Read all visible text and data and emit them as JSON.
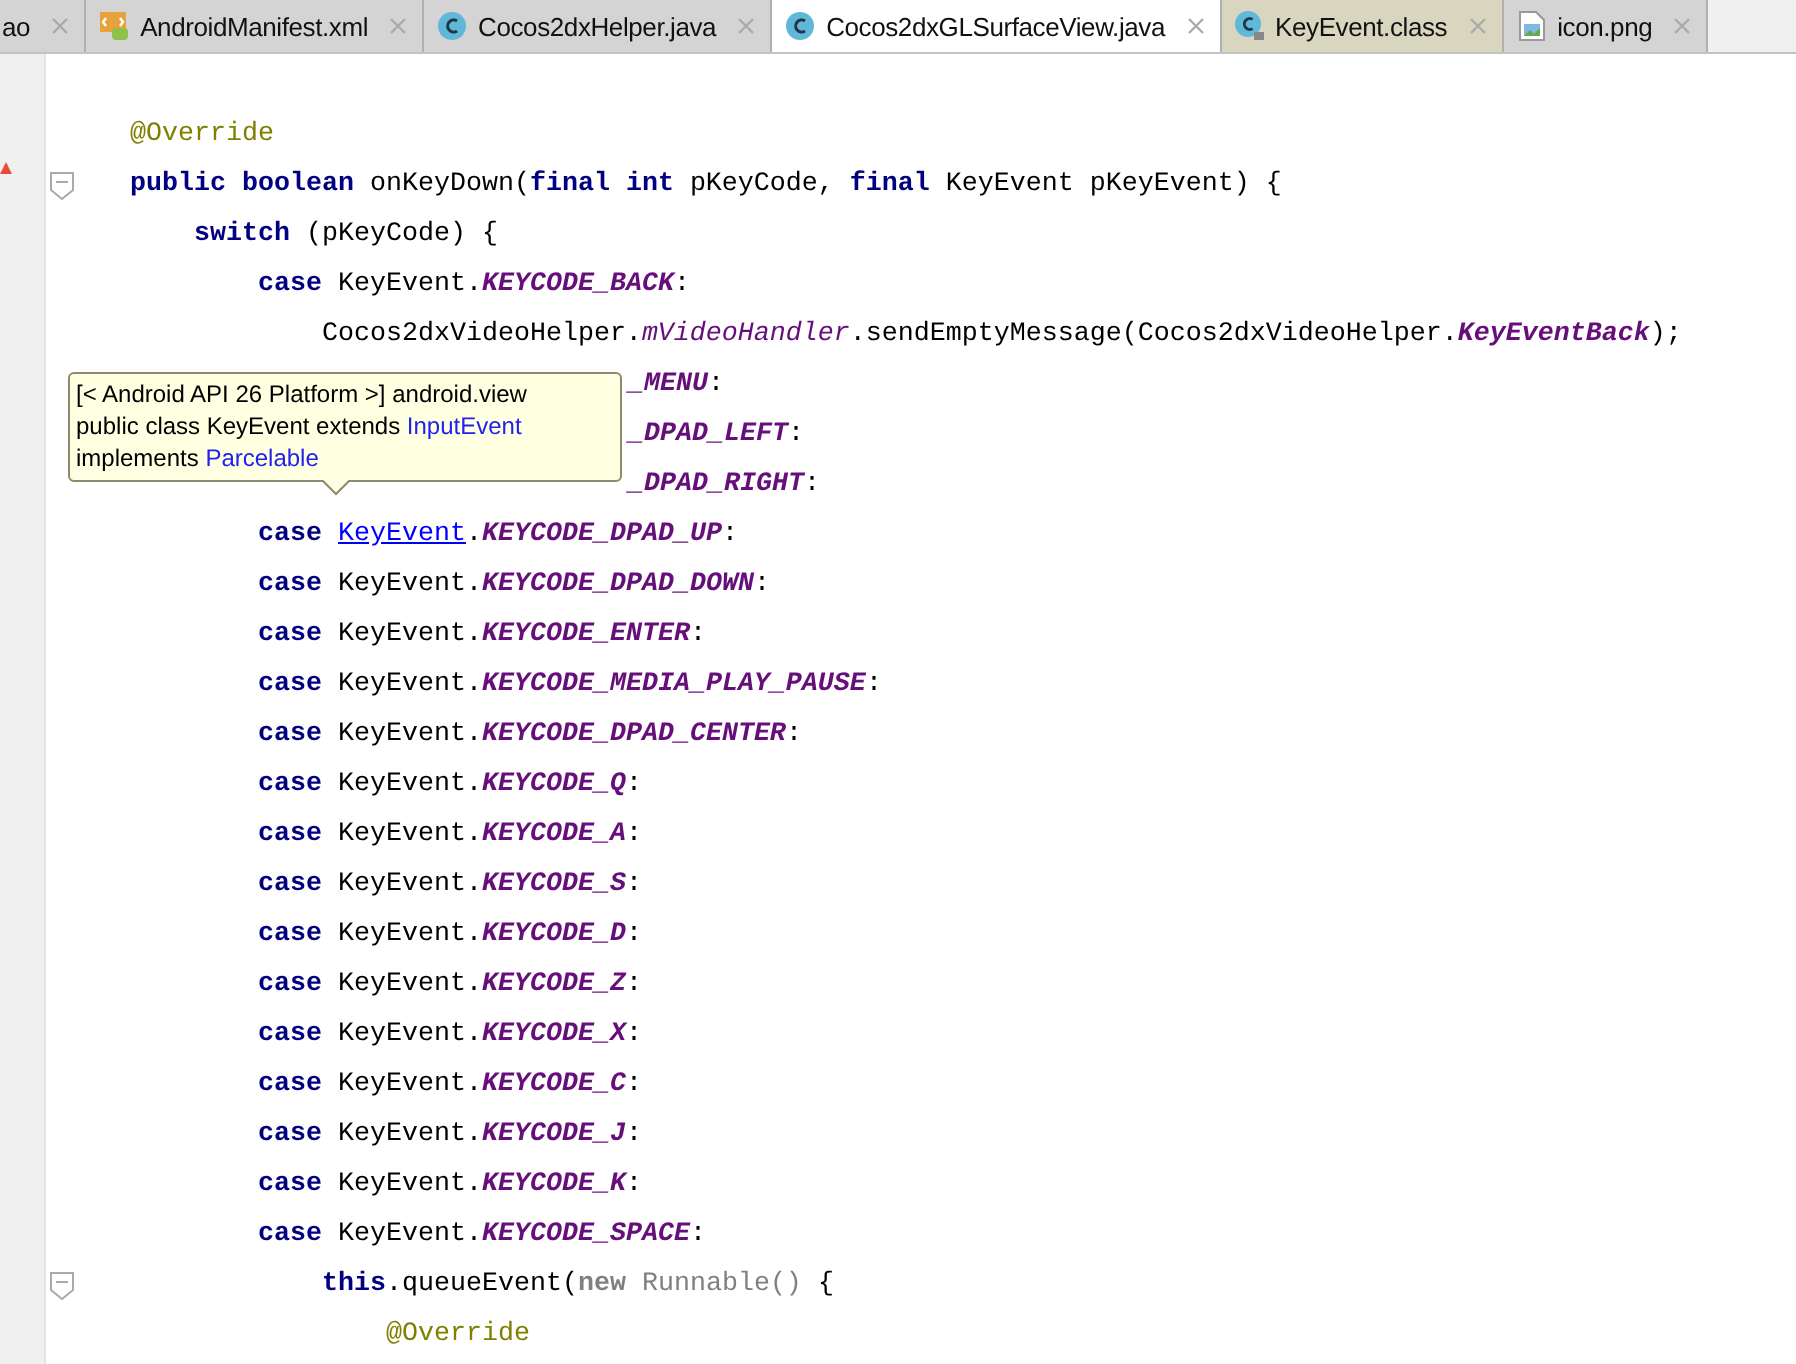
{
  "tabs": [
    {
      "label": "ao",
      "kind": "none",
      "selected": false
    },
    {
      "label": "AndroidManifest.xml",
      "kind": "xml",
      "selected": false
    },
    {
      "label": "Cocos2dxHelper.java",
      "kind": "java",
      "selected": false
    },
    {
      "label": "Cocos2dxGLSurfaceView.java",
      "kind": "java",
      "selected": true
    },
    {
      "label": "KeyEvent.class",
      "kind": "class",
      "selected": false
    },
    {
      "label": "icon.png",
      "kind": "image",
      "selected": false
    }
  ],
  "code_lines": [
    {
      "fold": false,
      "tokens": [
        {
          "text": "    @Override",
          "kind": "anno"
        }
      ]
    },
    {
      "fold": true,
      "tokens": [
        {
          "text": "    public boolean ",
          "kind": "kw"
        },
        {
          "text": "onKeyDown(",
          "kind": "plain"
        },
        {
          "text": "final int ",
          "kind": "kw"
        },
        {
          "text": "pKeyCode, ",
          "kind": "plain"
        },
        {
          "text": "final ",
          "kind": "kw"
        },
        {
          "text": "KeyEvent pKeyEvent) {",
          "kind": "plain"
        }
      ]
    },
    {
      "fold": false,
      "tokens": [
        {
          "text": "        switch ",
          "kind": "kw"
        },
        {
          "text": "(pKeyCode) {",
          "kind": "plain"
        }
      ]
    },
    {
      "fold": false,
      "tokens": [
        {
          "text": "            case ",
          "kind": "kw"
        },
        {
          "text": "KeyEvent.",
          "kind": "plain"
        },
        {
          "text": "KEYCODE_BACK",
          "kind": "const"
        },
        {
          "text": ":",
          "kind": "plain"
        }
      ]
    },
    {
      "fold": false,
      "tokens": [
        {
          "text": "                Cocos2dxVideoHelper.",
          "kind": "plain"
        },
        {
          "text": "mVideoHandler",
          "kind": "field"
        },
        {
          "text": ".sendEmptyMessage(Cocos2dxVideoHelper.",
          "kind": "plain"
        },
        {
          "text": "KeyEventBack",
          "kind": "const"
        },
        {
          "text": ");",
          "kind": "plain"
        }
      ]
    },
    {
      "fold": false,
      "kind": "partial",
      "tokens": [
        {
          "text": "_MENU",
          "kind": "const"
        },
        {
          "text": ":",
          "kind": "plain"
        }
      ]
    },
    {
      "fold": false,
      "kind": "partial",
      "tokens": [
        {
          "text": "_DPAD_LEFT",
          "kind": "const"
        },
        {
          "text": ":",
          "kind": "plain"
        }
      ]
    },
    {
      "fold": false,
      "kind": "partial",
      "tokens": [
        {
          "text": "_DPAD_RIGHT",
          "kind": "const"
        },
        {
          "text": ":",
          "kind": "plain"
        }
      ]
    },
    {
      "fold": false,
      "tokens": [
        {
          "text": "            case ",
          "kind": "kw"
        },
        {
          "text": "KeyEvent",
          "kind": "link"
        },
        {
          "text": ".",
          "kind": "plain"
        },
        {
          "text": "KEYCODE_DPAD_UP",
          "kind": "const"
        },
        {
          "text": ":",
          "kind": "plain"
        }
      ]
    },
    {
      "fold": false,
      "tokens": [
        {
          "text": "            case ",
          "kind": "kw"
        },
        {
          "text": "KeyEvent.",
          "kind": "plain"
        },
        {
          "text": "KEYCODE_DPAD_DOWN",
          "kind": "const"
        },
        {
          "text": ":",
          "kind": "plain"
        }
      ]
    },
    {
      "fold": false,
      "tokens": [
        {
          "text": "            case ",
          "kind": "kw"
        },
        {
          "text": "KeyEvent.",
          "kind": "plain"
        },
        {
          "text": "KEYCODE_ENTER",
          "kind": "const"
        },
        {
          "text": ":",
          "kind": "plain"
        }
      ]
    },
    {
      "fold": false,
      "tokens": [
        {
          "text": "            case ",
          "kind": "kw"
        },
        {
          "text": "KeyEvent.",
          "kind": "plain"
        },
        {
          "text": "KEYCODE_MEDIA_PLAY_PAUSE",
          "kind": "const"
        },
        {
          "text": ":",
          "kind": "plain"
        }
      ]
    },
    {
      "fold": false,
      "tokens": [
        {
          "text": "            case ",
          "kind": "kw"
        },
        {
          "text": "KeyEvent.",
          "kind": "plain"
        },
        {
          "text": "KEYCODE_DPAD_CENTER",
          "kind": "const"
        },
        {
          "text": ":",
          "kind": "plain"
        }
      ]
    },
    {
      "fold": false,
      "tokens": [
        {
          "text": "            case ",
          "kind": "kw"
        },
        {
          "text": "KeyEvent.",
          "kind": "plain"
        },
        {
          "text": "KEYCODE_Q",
          "kind": "const"
        },
        {
          "text": ":",
          "kind": "plain"
        }
      ]
    },
    {
      "fold": false,
      "tokens": [
        {
          "text": "            case ",
          "kind": "kw"
        },
        {
          "text": "KeyEvent.",
          "kind": "plain"
        },
        {
          "text": "KEYCODE_A",
          "kind": "const"
        },
        {
          "text": ":",
          "kind": "plain"
        }
      ]
    },
    {
      "fold": false,
      "tokens": [
        {
          "text": "            case ",
          "kind": "kw"
        },
        {
          "text": "KeyEvent.",
          "kind": "plain"
        },
        {
          "text": "KEYCODE_S",
          "kind": "const"
        },
        {
          "text": ":",
          "kind": "plain"
        }
      ]
    },
    {
      "fold": false,
      "tokens": [
        {
          "text": "            case ",
          "kind": "kw"
        },
        {
          "text": "KeyEvent.",
          "kind": "plain"
        },
        {
          "text": "KEYCODE_D",
          "kind": "const"
        },
        {
          "text": ":",
          "kind": "plain"
        }
      ]
    },
    {
      "fold": false,
      "tokens": [
        {
          "text": "            case ",
          "kind": "kw"
        },
        {
          "text": "KeyEvent.",
          "kind": "plain"
        },
        {
          "text": "KEYCODE_Z",
          "kind": "const"
        },
        {
          "text": ":",
          "kind": "plain"
        }
      ]
    },
    {
      "fold": false,
      "tokens": [
        {
          "text": "            case ",
          "kind": "kw"
        },
        {
          "text": "KeyEvent.",
          "kind": "plain"
        },
        {
          "text": "KEYCODE_X",
          "kind": "const"
        },
        {
          "text": ":",
          "kind": "plain"
        }
      ]
    },
    {
      "fold": false,
      "tokens": [
        {
          "text": "            case ",
          "kind": "kw"
        },
        {
          "text": "KeyEvent.",
          "kind": "plain"
        },
        {
          "text": "KEYCODE_C",
          "kind": "const"
        },
        {
          "text": ":",
          "kind": "plain"
        }
      ]
    },
    {
      "fold": false,
      "tokens": [
        {
          "text": "            case ",
          "kind": "kw"
        },
        {
          "text": "KeyEvent.",
          "kind": "plain"
        },
        {
          "text": "KEYCODE_J",
          "kind": "const"
        },
        {
          "text": ":",
          "kind": "plain"
        }
      ]
    },
    {
      "fold": false,
      "tokens": [
        {
          "text": "            case ",
          "kind": "kw"
        },
        {
          "text": "KeyEvent.",
          "kind": "plain"
        },
        {
          "text": "KEYCODE_K",
          "kind": "const"
        },
        {
          "text": ":",
          "kind": "plain"
        }
      ]
    },
    {
      "fold": false,
      "tokens": [
        {
          "text": "            case ",
          "kind": "kw"
        },
        {
          "text": "KeyEvent.",
          "kind": "plain"
        },
        {
          "text": "KEYCODE_SPACE",
          "kind": "const"
        },
        {
          "text": ":",
          "kind": "plain"
        }
      ]
    },
    {
      "fold": true,
      "tokens": [
        {
          "text": "                this",
          "kind": "kw"
        },
        {
          "text": ".queueEvent(",
          "kind": "plain"
        },
        {
          "text": "new ",
          "kind": "kw_muted"
        },
        {
          "text": "Runnable() ",
          "kind": "muted"
        },
        {
          "text": "{",
          "kind": "plain"
        }
      ]
    },
    {
      "fold": false,
      "tokens": [
        {
          "text": "                    @Override",
          "kind": "anno"
        }
      ]
    }
  ],
  "tooltip": {
    "lines": [
      [
        {
          "text": "[< Android API 26 Platform >] android.view",
          "kind": "plain"
        }
      ],
      [
        {
          "text": "public class KeyEvent extends ",
          "kind": "plain"
        },
        {
          "text": "InputEvent",
          "kind": "link"
        }
      ],
      [
        {
          "text": "implements ",
          "kind": "plain"
        },
        {
          "text": "Parcelable",
          "kind": "link"
        }
      ]
    ]
  }
}
